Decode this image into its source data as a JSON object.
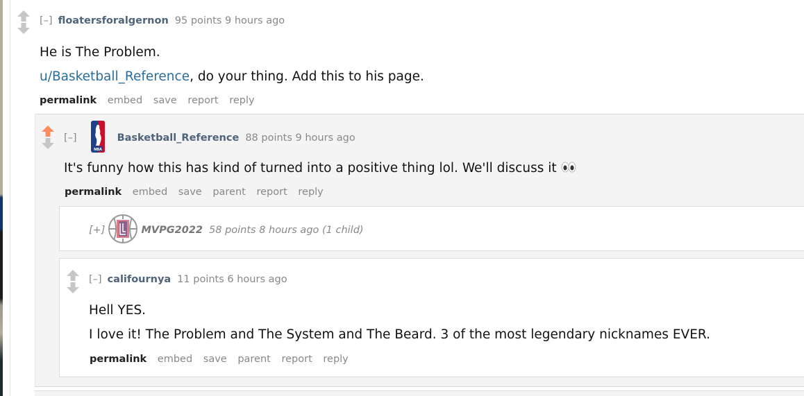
{
  "comments": {
    "top": {
      "collapse": "[–]",
      "author": "floatersforalgernon",
      "meta": "95 points 9 hours ago",
      "lines": [
        "He is The Problem."
      ],
      "mention_link": "u/Basketball_Reference",
      "mention_rest": ", do your thing. Add this to his page.",
      "buttons": [
        "permalink",
        "embed",
        "save",
        "report",
        "reply"
      ],
      "upvoted": false
    },
    "reply1": {
      "collapse": "[–]",
      "author": "Basketball_Reference",
      "flair_icon": "nba-logo-icon",
      "meta": "88 points 9 hours ago",
      "text": "It's funny how this has kind of turned into a positive thing lol. We'll discuss it",
      "emoji": "eyes-emoji",
      "buttons": [
        "permalink",
        "embed",
        "save",
        "parent",
        "report",
        "reply"
      ],
      "upvoted": true
    },
    "reply_collapsed": {
      "expand": "[+]",
      "flair_icon": "clippers-logo-icon",
      "author": "MVPG2022",
      "meta": "58 points 8 hours ago (1 child)"
    },
    "reply2": {
      "collapse": "[–]",
      "author": "califournya",
      "meta": "11 points 6 hours ago",
      "lines": [
        "Hell YES.",
        "I love it! The Problem and The System and The Beard. 3 of the most legendary nicknames EVER."
      ],
      "buttons": [
        "permalink",
        "embed",
        "save",
        "parent",
        "report",
        "reply"
      ],
      "upvoted": false
    }
  },
  "colors": {
    "upvote_active": "#ff8b60",
    "arrow_inactive": "#c6c6c6",
    "author": "#4f637a",
    "link": "#2a6d9c",
    "meta": "#888888"
  }
}
